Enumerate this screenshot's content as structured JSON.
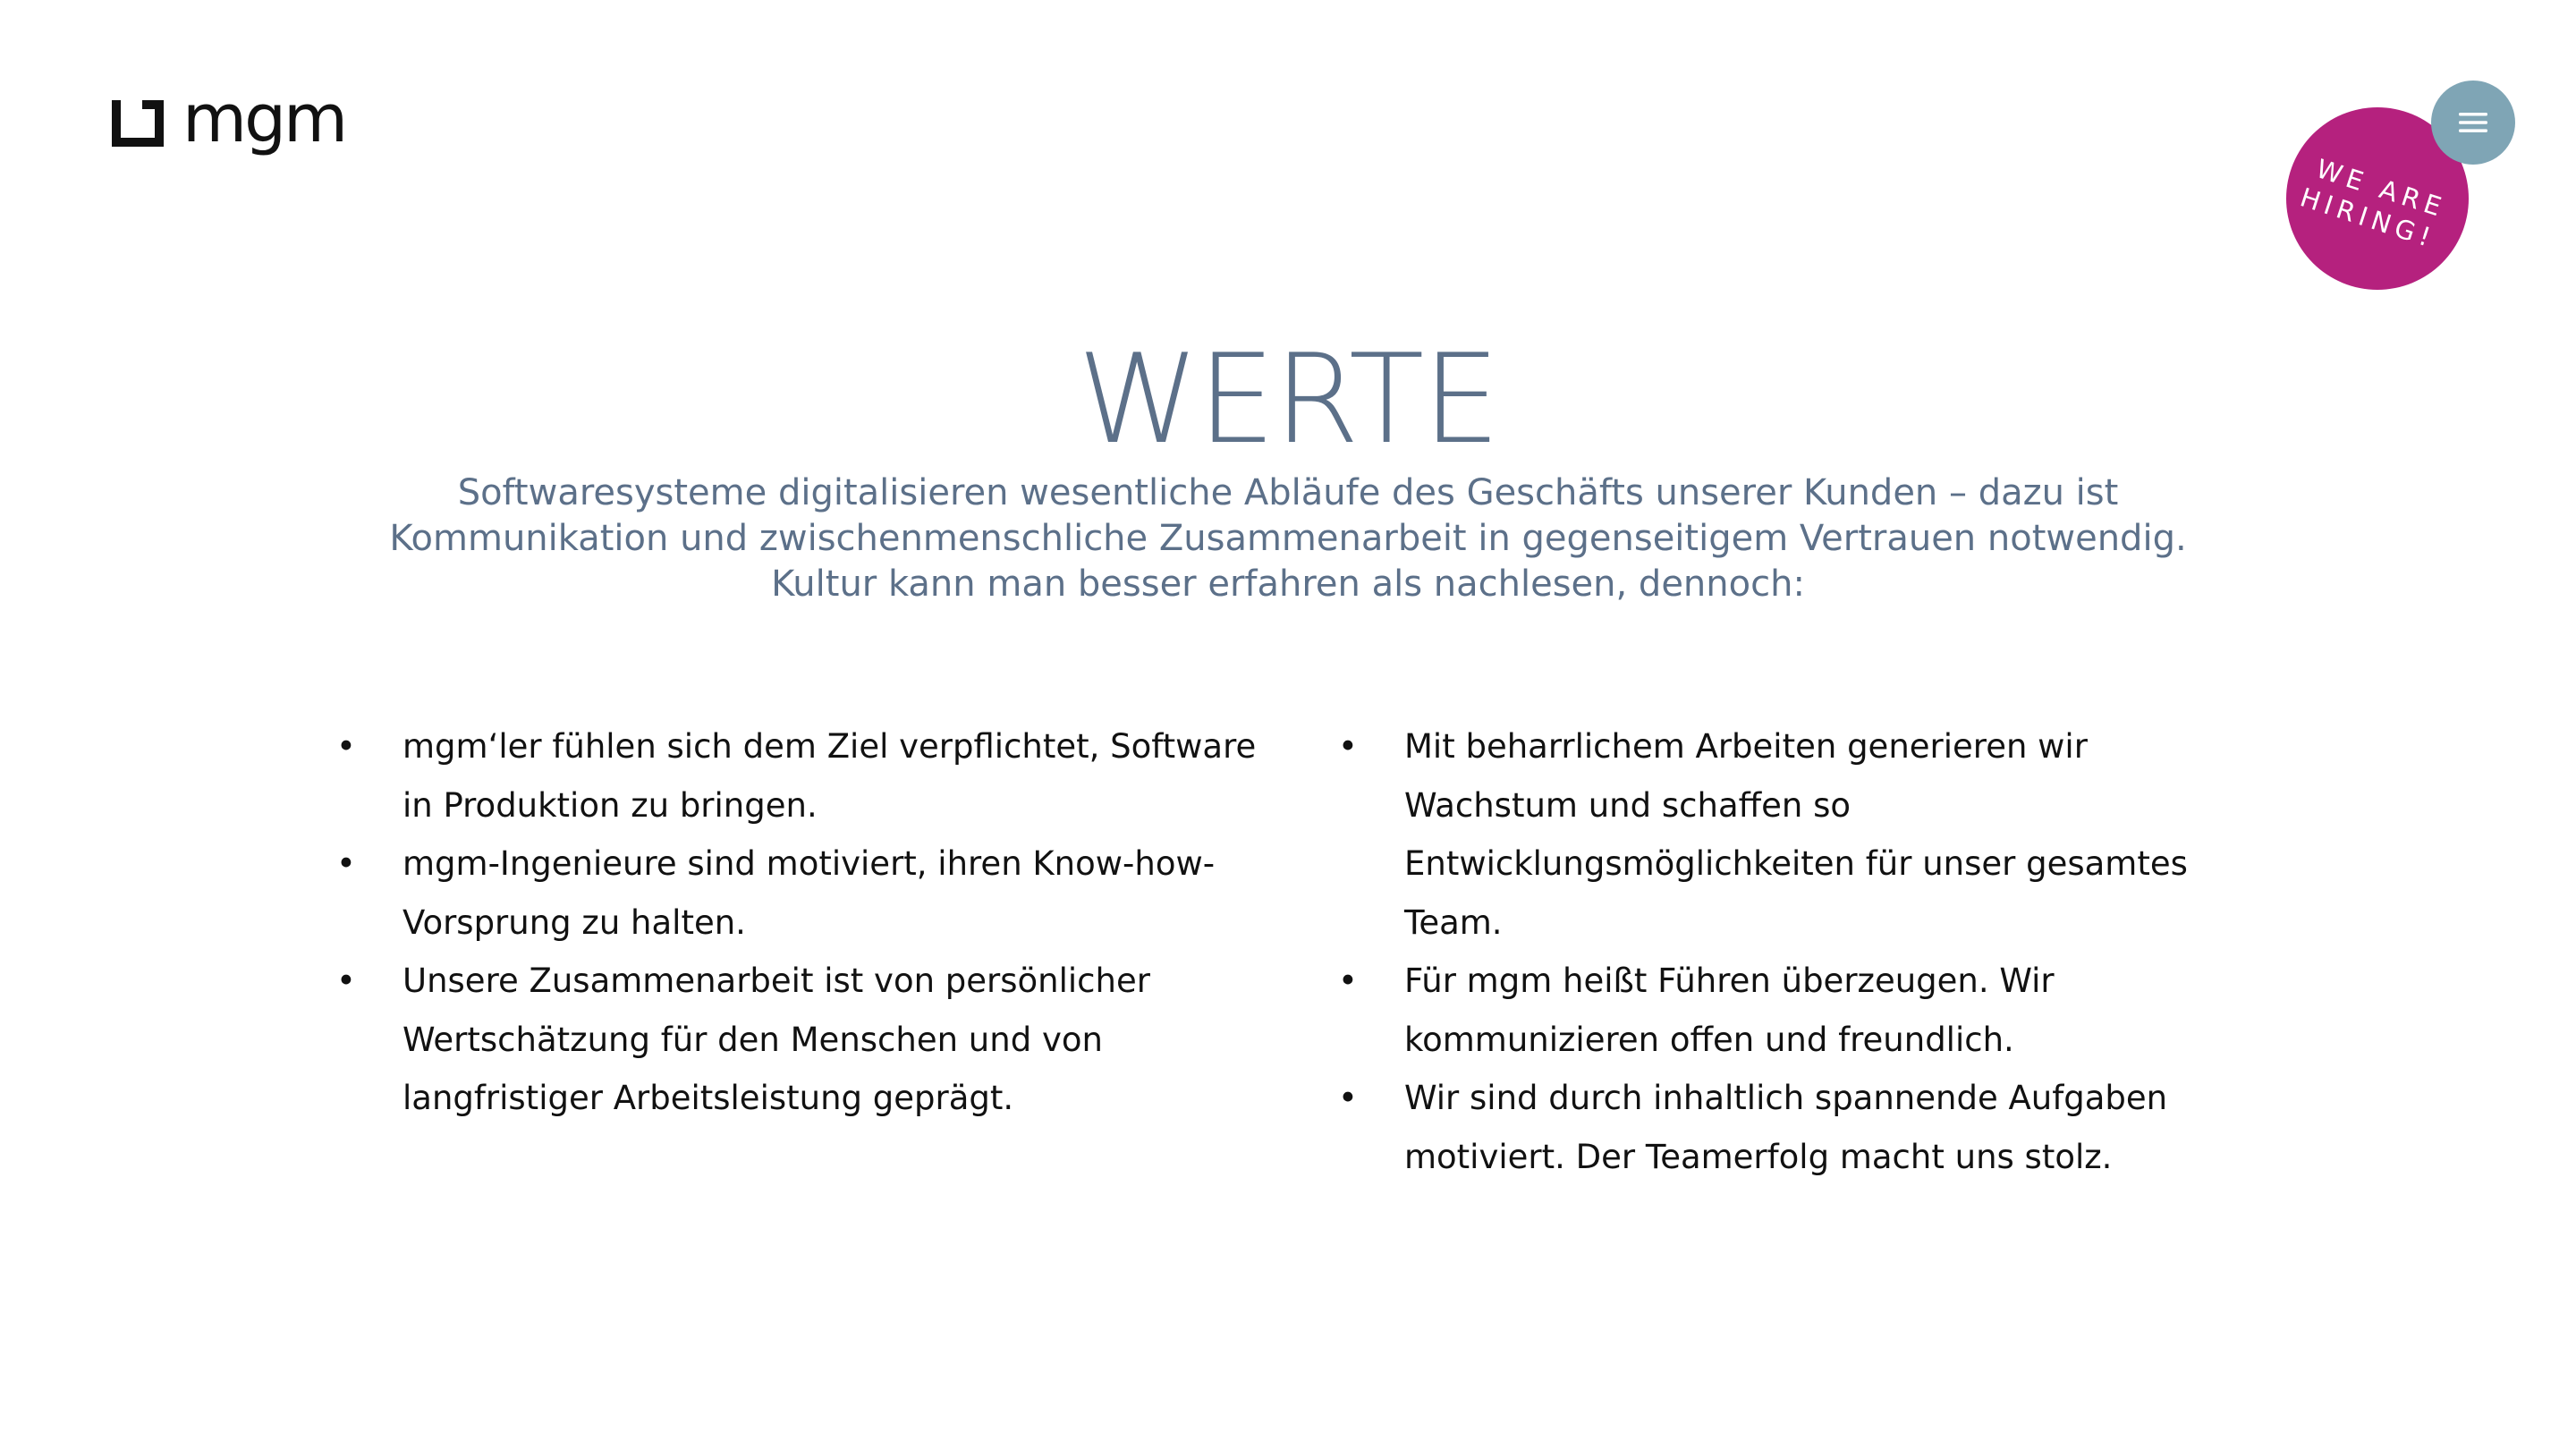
{
  "header": {
    "logo_text": "mgm",
    "menu_icon": "hamburger-menu-icon",
    "hiring_badge": {
      "line1": "WE ARE",
      "line2": "HIRING!",
      "color": "#b5217e"
    }
  },
  "main": {
    "title": "WERTE",
    "intro": [
      "Softwaresysteme digitalisieren wesentliche Abläufe des Geschäfts unserer Kunden – dazu ist",
      "Kommunikation und zwischenmenschliche Zusammenarbeit in gegenseitigem Vertrauen notwendig.",
      "Kultur kann man besser erfahren als nachlesen, dennoch:"
    ],
    "bullet": "•",
    "left_list": [
      "mgm‘ler fühlen sich dem Ziel verpflichtet, Software in Produktion zu bringen.",
      "mgm-Ingenieure sind motiviert, ihren Know-how-Vorsprung zu halten.",
      "Unsere Zusammenarbeit ist von persönlicher Wertschätzung für den Menschen und von langfristiger Arbeitsleistung geprägt."
    ],
    "right_list": [
      "Mit beharrlichem Arbeiten generieren wir Wachstum und schaffen so Entwicklungsmöglichkeiten für unser gesamtes Team.",
      "Für mgm heißt Führen überzeugen. Wir kommunizieren offen und freundlich.",
      "Wir sind durch inhaltlich spannende Aufgaben motiviert. Der Teamerfolg macht uns stolz."
    ]
  },
  "colors": {
    "accent_text": "#5c7089",
    "menu_button": "#7fa5b5",
    "body_text": "#111111"
  }
}
